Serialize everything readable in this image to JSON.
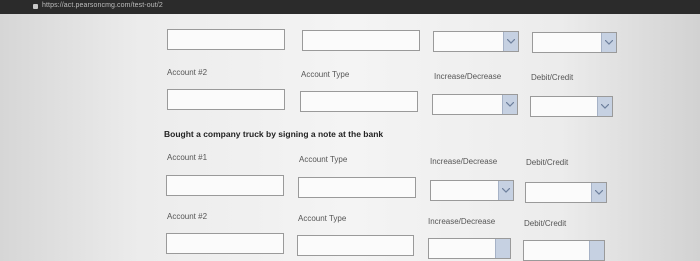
{
  "browser": {
    "url": "https://act.pearsoncmg.com/test-out/2"
  },
  "row_labels": {
    "account1": "Account #1",
    "account2": "Account #2",
    "account_type": "Account Type",
    "increase_decrease": "Increase/Decrease",
    "debit_credit": "Debit/Credit"
  },
  "transaction": {
    "heading": "Bought a company truck by signing a note at the bank"
  }
}
